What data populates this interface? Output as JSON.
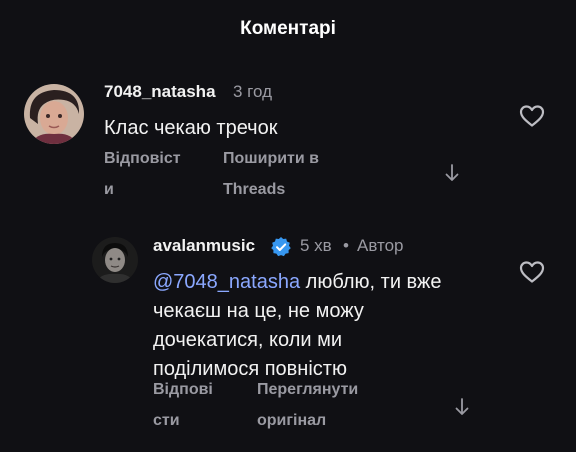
{
  "header": {
    "title": "Коментарі"
  },
  "comments": [
    {
      "username": "7048_natasha",
      "time": "3 год",
      "text": "Клас чекаю тречок",
      "reply_line1": "Відповіст",
      "reply_line2": "и",
      "share_line1": "Поширити в",
      "share_line2": "Threads",
      "like_icon": "heart-outline-icon",
      "expand_icon": "arrow-down-icon"
    },
    {
      "username": "avalanmusic",
      "verified_icon": "verified-badge-icon",
      "time": "5 хв",
      "separator": "•",
      "author_badge": "Автор",
      "mention": "@7048_natasha",
      "line1_rest": " люблю, ти вже",
      "line2": "чекаєш на це, не можу",
      "line3": "дочекатися, коли ми",
      "line4": "поділимося повністю",
      "reply_line1": "Відпові",
      "reply_line2": "сти",
      "original_line1": "Переглянути",
      "original_line2": "оригінал",
      "like_icon": "heart-outline-icon",
      "expand_icon": "arrow-down-icon"
    }
  ],
  "colors": {
    "background": "#101014",
    "primary_text": "#f2f2f2",
    "secondary_text": "#9a9aa2",
    "mention": "#8ba8ff",
    "verified": "#3797f0"
  }
}
